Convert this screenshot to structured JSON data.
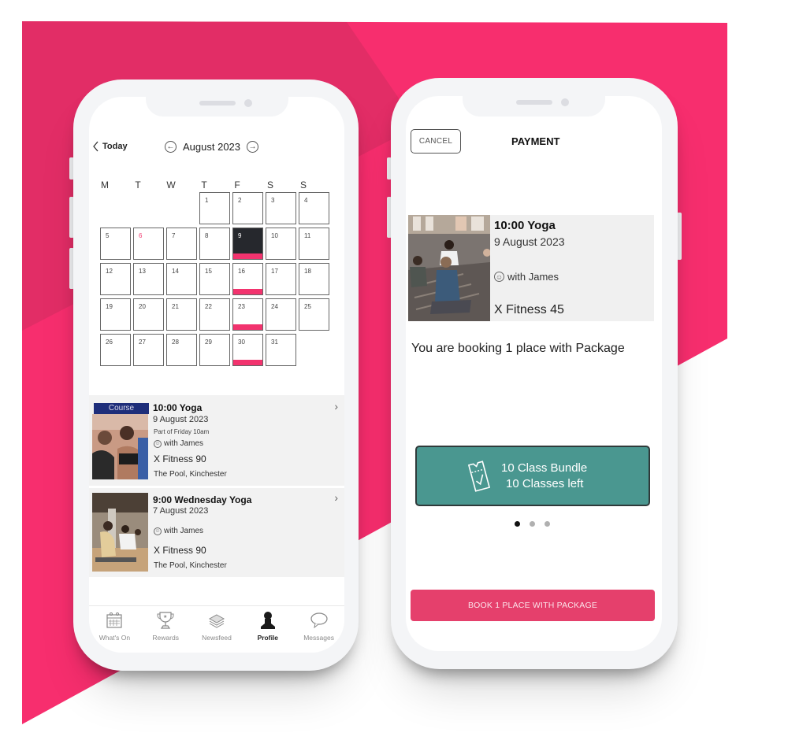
{
  "colors": {
    "brand_pink": "#f72e6e",
    "brand_pink_dark": "#e22d66",
    "event_bar": "#f2336e",
    "selected_day": "#26282d",
    "course_tag": "#1e2e7a",
    "package_teal": "#4a9790",
    "book_button": "#e5406c"
  },
  "left_phone": {
    "header": {
      "back_label": "Today",
      "month_label": "August 2023",
      "prev_icon": "arrow-left-circle-icon",
      "next_icon": "arrow-right-circle-icon"
    },
    "calendar": {
      "weekdays": [
        "M",
        "T",
        "W",
        "T",
        "F",
        "S",
        "S"
      ],
      "first_weekday_index": 3,
      "days": [
        {
          "n": "1"
        },
        {
          "n": "2"
        },
        {
          "n": "3"
        },
        {
          "n": "4"
        },
        {
          "n": "5"
        },
        {
          "n": "6",
          "today": true
        },
        {
          "n": "7"
        },
        {
          "n": "8"
        },
        {
          "n": "9",
          "selected": true,
          "event": true
        },
        {
          "n": "10"
        },
        {
          "n": "11"
        },
        {
          "n": "12"
        },
        {
          "n": "13"
        },
        {
          "n": "14"
        },
        {
          "n": "15"
        },
        {
          "n": "16",
          "event": true
        },
        {
          "n": "17"
        },
        {
          "n": "18"
        },
        {
          "n": "19"
        },
        {
          "n": "20"
        },
        {
          "n": "21"
        },
        {
          "n": "22"
        },
        {
          "n": "23",
          "event": true
        },
        {
          "n": "24"
        },
        {
          "n": "25"
        },
        {
          "n": "26"
        },
        {
          "n": "27"
        },
        {
          "n": "28"
        },
        {
          "n": "29"
        },
        {
          "n": "30",
          "event": true
        },
        {
          "n": "31"
        }
      ]
    },
    "events": [
      {
        "tag": "Course",
        "title": "10:00 Yoga",
        "date": "9 August 2023",
        "part_of": "Part of Friday 10am",
        "instructor": "with James",
        "venue": "X Fitness 90",
        "location": "The Pool, Kinchester"
      },
      {
        "title": "9:00 Wednesday Yoga",
        "date": "7 August 2023",
        "instructor": "with James",
        "venue": "X Fitness 90",
        "location": "The Pool, Kinchester"
      }
    ],
    "tabs": [
      {
        "label": "What's On",
        "icon": "calendar-icon"
      },
      {
        "label": "Rewards",
        "icon": "trophy-icon"
      },
      {
        "label": "Newsfeed",
        "icon": "layers-icon"
      },
      {
        "label": "Profile",
        "icon": "person-icon",
        "active": true
      },
      {
        "label": "Messages",
        "icon": "chat-bubble-icon"
      }
    ]
  },
  "right_phone": {
    "cancel_label": "CANCEL",
    "title": "PAYMENT",
    "booking": {
      "title": "10:00 Yoga",
      "date": "9 August 2023",
      "instructor": "with James",
      "venue": "X Fitness 45"
    },
    "booking_text": "You are booking 1 place with Package",
    "package": {
      "name": "10 Class Bundle",
      "remaining": "10 Classes left",
      "icon": "ticket-check-icon"
    },
    "carousel": {
      "count": 3,
      "active_index": 0
    },
    "book_button_label": "BOOK 1 PLACE WITH PACKAGE"
  }
}
